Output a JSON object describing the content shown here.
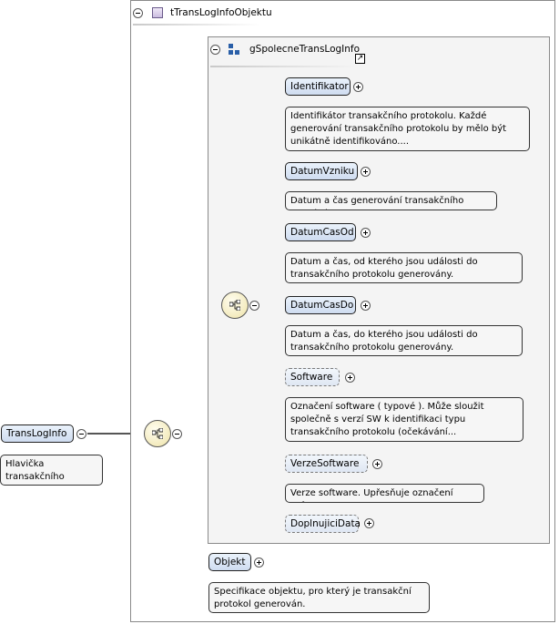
{
  "complex_type": {
    "name": "tTransLogInfoObjektu",
    "collapse": "−"
  },
  "group": {
    "name": "gSpolecneTransLogInfo",
    "collapse": "−",
    "link_icon": "↗"
  },
  "root": {
    "name": "TransLogInfo",
    "doc": "Hlavička transakčního protokolu."
  },
  "group_elements": [
    {
      "name": "Identifikator",
      "doc": "Identifikátor transakčního protokolu. Každé generování transakčního protokolu by mělo být unikátně identifikováno...."
    },
    {
      "name": "DatumVzniku",
      "doc": "Datum a čas generování transakčního protokolu."
    },
    {
      "name": "DatumCasOd",
      "doc": "Datum a čas, od kterého jsou události do transakčního protokolu generovány."
    },
    {
      "name": "DatumCasDo",
      "doc": "Datum a čas, do kterého jsou události do transakčního protokolu generovány."
    },
    {
      "name": "Software",
      "doc": "Označení software ( typové ). Může sloužit společně s verzí SW k identifikaci typu transakčního protokolu (očekávání..."
    },
    {
      "name": "VerzeSoftware",
      "doc": "Verze software. Upřesňuje označení software."
    },
    {
      "name": "DoplnujiciData",
      "doc": ""
    }
  ],
  "objekt": {
    "name": "Objekt",
    "doc": "Specifikace objektu, pro který je transakční protokol generován."
  },
  "colors": {
    "element_fill_top": "#eaf2fb",
    "element_fill_bottom": "#cfdcf0",
    "compositor": "#eee3a8",
    "group_bg": "#f4f4f4"
  },
  "icons": {
    "type_icon": "complex-type-icon",
    "group_icon": "group-icon",
    "sequence_icon": "sequence-compositor-icon"
  }
}
